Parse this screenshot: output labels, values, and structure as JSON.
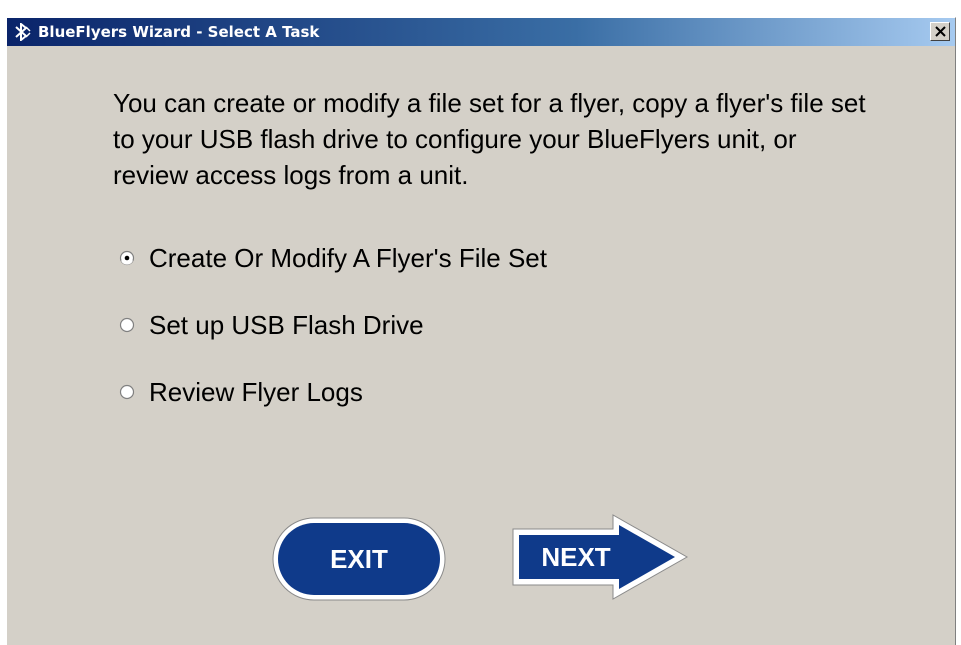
{
  "window": {
    "title": "BlueFlyers Wizard - Select A Task",
    "title_icon": "bluetooth-icon",
    "close_icon": "close-icon"
  },
  "description": "You can create or modify a file set for a flyer, copy a flyer's file set to your USB flash drive to configure your BlueFlyers unit, or review access logs from a unit.",
  "options": [
    {
      "label": "Create Or Modify A Flyer's File Set",
      "selected": true
    },
    {
      "label": "Set up USB Flash Drive",
      "selected": false
    },
    {
      "label": "Review Flyer Logs",
      "selected": false
    }
  ],
  "buttons": {
    "exit_label": "EXIT",
    "next_label": "NEXT"
  },
  "colors": {
    "button_blue": "#0f3a8a",
    "window_bg": "#d4d0c8"
  }
}
